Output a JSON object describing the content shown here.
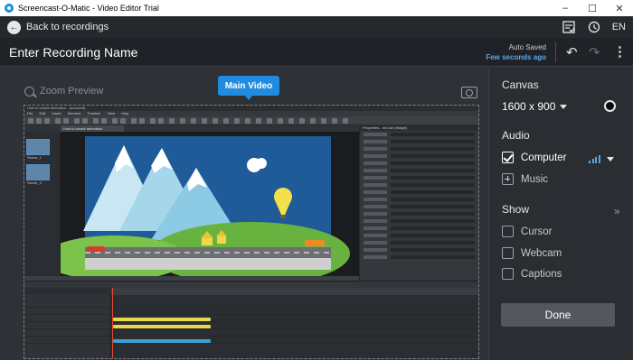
{
  "window": {
    "title": "Screencast-O-Matic - Video Editor Trial",
    "minimize": "–",
    "maximize": "☐",
    "close": "✕"
  },
  "nav": {
    "back_label": "Back to recordings",
    "language": "EN"
  },
  "recording": {
    "name": "Enter Recording Name",
    "autosave_status": "Auto Saved",
    "autosave_time": "Few seconds ago",
    "undo": "↶",
    "redo": "↷",
    "more": "⋮"
  },
  "preview": {
    "zoom_label": "Zoom Preview",
    "main_video_badge": "Main Video"
  },
  "captured_editor": {
    "title": "How to create animation - (unsaved)",
    "menu": "File  Edit  Insert  Element  Timeline  View  Help",
    "tab": "How to create animation",
    "scene_labels": [
      "Scene_1",
      "Scene_2"
    ],
    "properties_title": "Properties - red car (Image)"
  },
  "panel": {
    "canvas_heading": "Canvas",
    "canvas_size": "1600 x 900",
    "canvas_color": "#000000",
    "audio_heading": "Audio",
    "audio_source": "Computer",
    "audio_source_checked": true,
    "music_label": "Music",
    "show_heading": "Show",
    "show_options": [
      {
        "label": "Cursor",
        "checked": false
      },
      {
        "label": "Webcam",
        "checked": false
      },
      {
        "label": "Captions",
        "checked": false
      }
    ],
    "done_label": "Done"
  },
  "colors": {
    "accent": "#1f8ce0",
    "audio_meter": "#4aa8f0"
  },
  "icons": [
    "task-icon",
    "history-icon",
    "search-icon",
    "camera-icon",
    "volume-meter-icon",
    "expand-icon"
  ]
}
